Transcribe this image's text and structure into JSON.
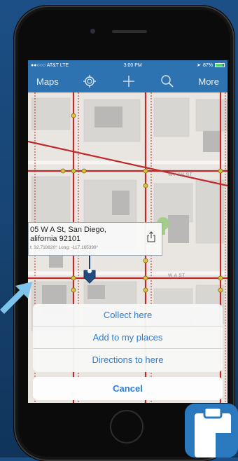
{
  "status": {
    "carrier": "●●○○○ AT&T  LTE",
    "time": "3:00 PM",
    "battery": "87%",
    "battery_level": 0.87
  },
  "nav": {
    "maps_label": "Maps",
    "more_label": "More"
  },
  "map": {
    "street_label_ash": "W ASH ST",
    "street_label_a": "W A ST"
  },
  "popup": {
    "line1": "05 W A St, San Diego,",
    "line2": "alifornia 92101",
    "coords": "t: 32.718820° Long: -117.165399°"
  },
  "action_sheet": {
    "items": [
      "Collect here",
      "Add to my places",
      "Directions to here"
    ],
    "cancel": "Cancel"
  },
  "colors": {
    "nav_blue": "#2e73b1",
    "action_blue": "#2a7dd8",
    "road_red": "#c0282a",
    "background_blue": "#1c4f86"
  }
}
